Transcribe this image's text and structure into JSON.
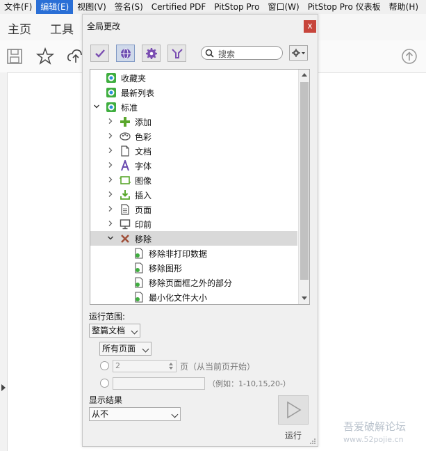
{
  "menu": [
    "文件(F)",
    "编辑(E)",
    "视图(V)",
    "签名(S)",
    "Certified PDF",
    "PitStop Pro",
    "窗口(W)",
    "PitStop Pro 仪表板",
    "帮助(H)"
  ],
  "app_tabs": {
    "home": "主页",
    "tools": "工具"
  },
  "dialog": {
    "title": "全局更改",
    "close": "x",
    "search_placeholder": "搜索",
    "tree": [
      {
        "label": "收藏夹"
      },
      {
        "label": "最新列表"
      },
      {
        "label": "标准"
      },
      {
        "label": "添加"
      },
      {
        "label": "色彩"
      },
      {
        "label": "文档"
      },
      {
        "label": "字体"
      },
      {
        "label": "图像"
      },
      {
        "label": "插入"
      },
      {
        "label": "页面"
      },
      {
        "label": "印前"
      },
      {
        "label": "移除"
      },
      {
        "label": "移除非打印数据"
      },
      {
        "label": "移除图形"
      },
      {
        "label": "移除页面框之外的部分"
      },
      {
        "label": "最小化文件大小"
      }
    ],
    "run_scope_label": "运行范围:",
    "scope_value": "整篇文档",
    "pages_value": "所有页面",
    "page_num_value": "2",
    "page_suffix": "页（从当前页开始）",
    "range_example": "（例如：1-10,15,20-）",
    "show_results_label": "显示结果",
    "show_results_value": "从不",
    "run_label": "运行"
  },
  "watermark": {
    "line1": "吾爱破解论坛",
    "line2": "www.52pojie.cn"
  },
  "colors": {
    "menu_active": "#2a6fd6",
    "close_button": "#c7453b",
    "tree_selected": "#d9d9d9"
  }
}
